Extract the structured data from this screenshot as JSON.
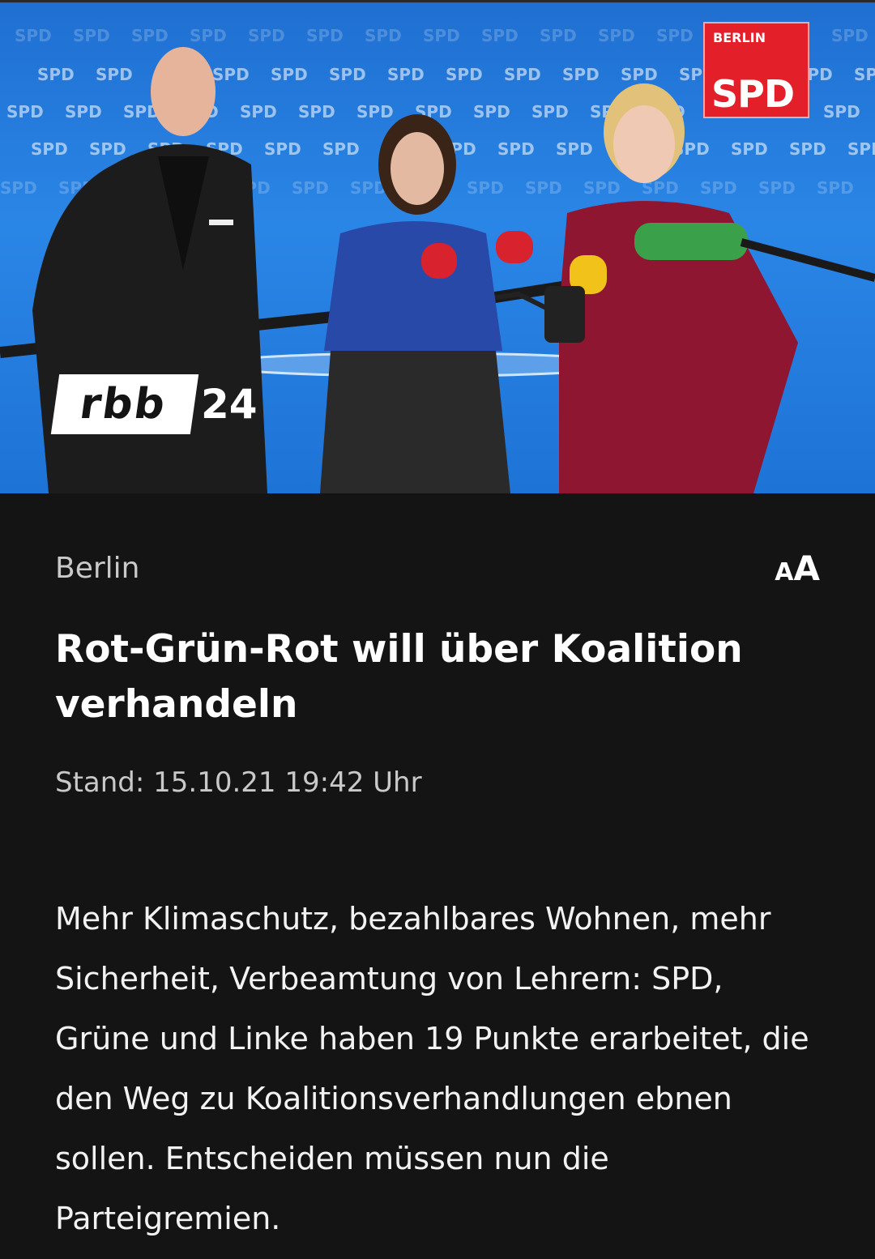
{
  "hero": {
    "alt_description": "",
    "backdrop_repeated_text": "SPD",
    "sign": {
      "city": "BERLIN",
      "party": "SPD",
      "color": "#e3202a"
    },
    "logo": {
      "brand": "rbb",
      "number": "24"
    }
  },
  "article": {
    "category": "Berlin",
    "font_size_toggle": {
      "small": "A",
      "big": "A"
    },
    "headline": "Rot-Grün-Rot will über Koalition verhandeln",
    "timestamp": "Stand: 15.10.21 19:42 Uhr",
    "teaser": "Mehr Klimaschutz, bezahlbares Wohnen, mehr Sicherheit, Verbeamtung von Lehrern: SPD, Grüne und Linke haben 19 Punkte erarbeitet, die den Weg zu Koalitionsverhandlungen ebnen sollen. Entscheiden müssen nun die Parteigremien."
  },
  "colors": {
    "background": "#141414",
    "headline": "#ffffff",
    "meta_text": "#c9c9c9",
    "backdrop_blue": "#2a86e6"
  }
}
